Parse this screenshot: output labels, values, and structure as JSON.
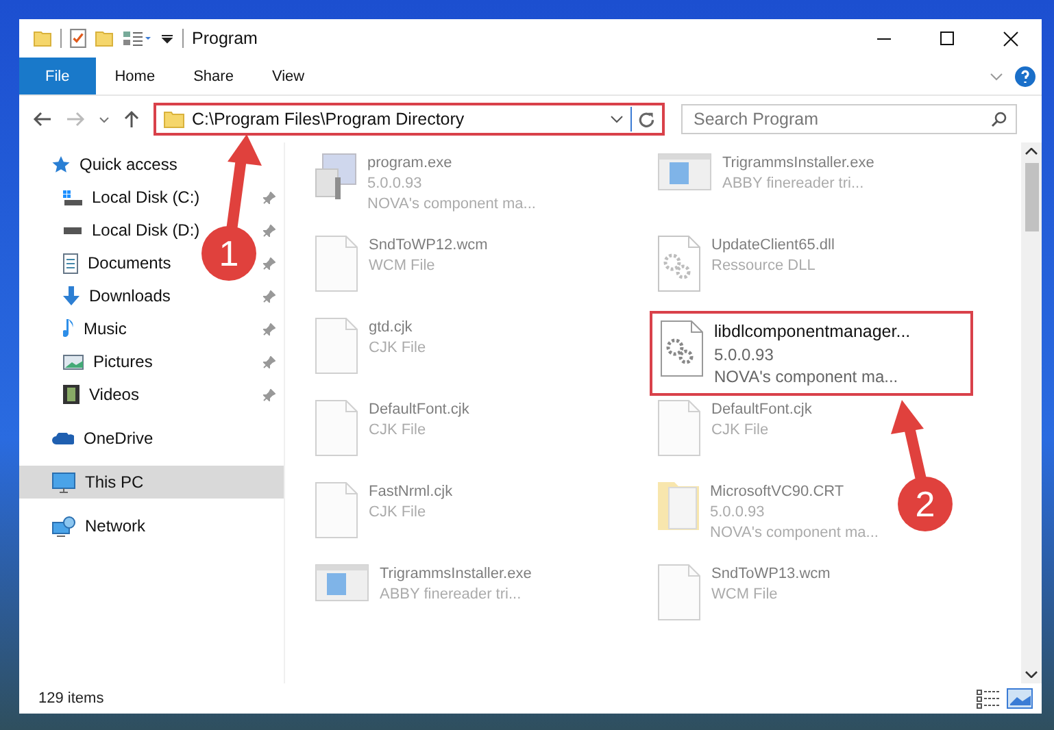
{
  "window": {
    "title": "Program"
  },
  "ribbon_tabs": [
    {
      "label": "File",
      "selected": true
    },
    {
      "label": "Home",
      "selected": false
    },
    {
      "label": "Share",
      "selected": false
    },
    {
      "label": "View",
      "selected": false
    }
  ],
  "address_bar": {
    "path": "C:\\Program Files\\Program Directory",
    "highlighted": true
  },
  "search": {
    "placeholder": "Search Program"
  },
  "sidebar": {
    "items": [
      {
        "label": "Quick access",
        "kind": "star",
        "selected": false,
        "children": [
          {
            "label": "Local Disk (C:)",
            "kind": "drive-win",
            "pinned": true,
            "selected": false
          },
          {
            "label": "Local Disk (D:)",
            "kind": "drive",
            "pinned": true,
            "selected": false
          },
          {
            "label": "Documents",
            "kind": "document",
            "pinned": true,
            "selected": false
          },
          {
            "label": "Downloads",
            "kind": "download",
            "pinned": true,
            "selected": false
          },
          {
            "label": "Music",
            "kind": "music",
            "pinned": true,
            "selected": false
          },
          {
            "label": "Pictures",
            "kind": "picture",
            "pinned": true,
            "selected": false
          },
          {
            "label": "Videos",
            "kind": "video",
            "pinned": true,
            "selected": false
          }
        ]
      },
      {
        "label": "OneDrive",
        "kind": "cloud",
        "selected": false
      },
      {
        "label": "This PC",
        "kind": "pc",
        "selected": true
      },
      {
        "label": "Network",
        "kind": "network",
        "selected": false
      }
    ]
  },
  "files": [
    {
      "name": "program.exe",
      "details": [
        "5.0.0.93",
        "NOVA's component ma..."
      ],
      "kind": "app",
      "highlighted": false
    },
    {
      "name": "TrigrammsInstaller.exe",
      "details": [
        "ABBY finereader tri..."
      ],
      "kind": "installer",
      "highlighted": false
    },
    {
      "name": "SndToWP12.wcm",
      "details": [
        "WCM File"
      ],
      "kind": "blank",
      "highlighted": false
    },
    {
      "name": "UpdateClient65.dll",
      "details": [
        "Ressource DLL"
      ],
      "kind": "gear",
      "highlighted": false
    },
    {
      "name": "gtd.cjk",
      "details": [
        "CJK File"
      ],
      "kind": "blank",
      "highlighted": false
    },
    {
      "name": "libdlcomponentmanager...",
      "details": [
        "5.0.0.93",
        "NOVA's component ma..."
      ],
      "kind": "gear",
      "highlighted": true
    },
    {
      "name": "DefaultFont.cjk",
      "details": [
        "CJK File"
      ],
      "kind": "blank",
      "highlighted": false
    },
    {
      "name": "DefaultFont.cjk",
      "details": [
        "CJK File"
      ],
      "kind": "blank",
      "highlighted": false
    },
    {
      "name": "FastNrml.cjk",
      "details": [
        "CJK File"
      ],
      "kind": "blank",
      "highlighted": false
    },
    {
      "name": "MicrosoftVC90.CRT",
      "details": [
        "5.0.0.93",
        "NOVA's component ma..."
      ],
      "kind": "folder",
      "highlighted": false
    },
    {
      "name": "TrigrammsInstaller.exe",
      "details": [
        "ABBY finereader tri..."
      ],
      "kind": "installer",
      "highlighted": false
    },
    {
      "name": "SndToWP13.wcm",
      "details": [
        "WCM File"
      ],
      "kind": "blank",
      "highlighted": false
    }
  ],
  "status_bar": {
    "count": "129 items"
  },
  "annotations": [
    {
      "number": "1"
    },
    {
      "number": "2"
    }
  ]
}
